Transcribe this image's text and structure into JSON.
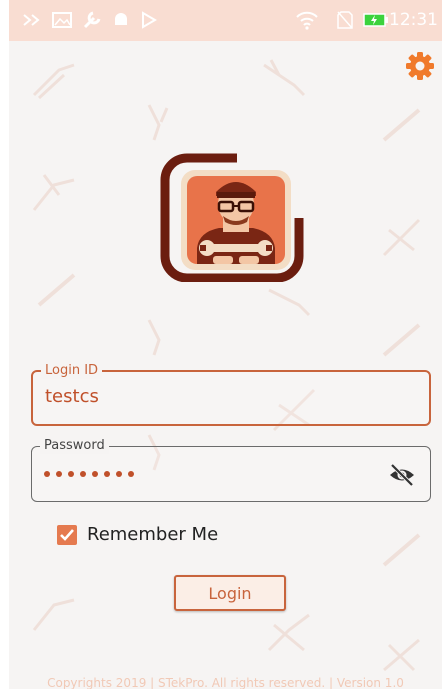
{
  "status_bar": {
    "time": "12:31",
    "icons": [
      "chevrons-icon",
      "image-icon",
      "wrench-icon",
      "android-icon",
      "play-store-icon",
      "wifi-icon",
      "no-sim-icon",
      "battery-charging-icon"
    ]
  },
  "header": {
    "settings_icon": "gear-icon"
  },
  "login_form": {
    "login_id": {
      "label": "Login ID",
      "value": "testcs"
    },
    "password": {
      "label": "Password",
      "masked_value": "••••••••",
      "toggle_icon": "eye-off-icon"
    },
    "remember_me": {
      "label": "Remember Me",
      "checked": true
    },
    "submit_label": "Login"
  },
  "footer": {
    "text": "Copyrights 2019 | STekPro. All rights reserved. | Version 1.0"
  },
  "colors": {
    "accent": "#c8643c",
    "status_bar": "#f9ddd2",
    "logo_brown": "#6b1d0f",
    "logo_orange": "#e8734a",
    "checkbox": "#e57a4f"
  }
}
